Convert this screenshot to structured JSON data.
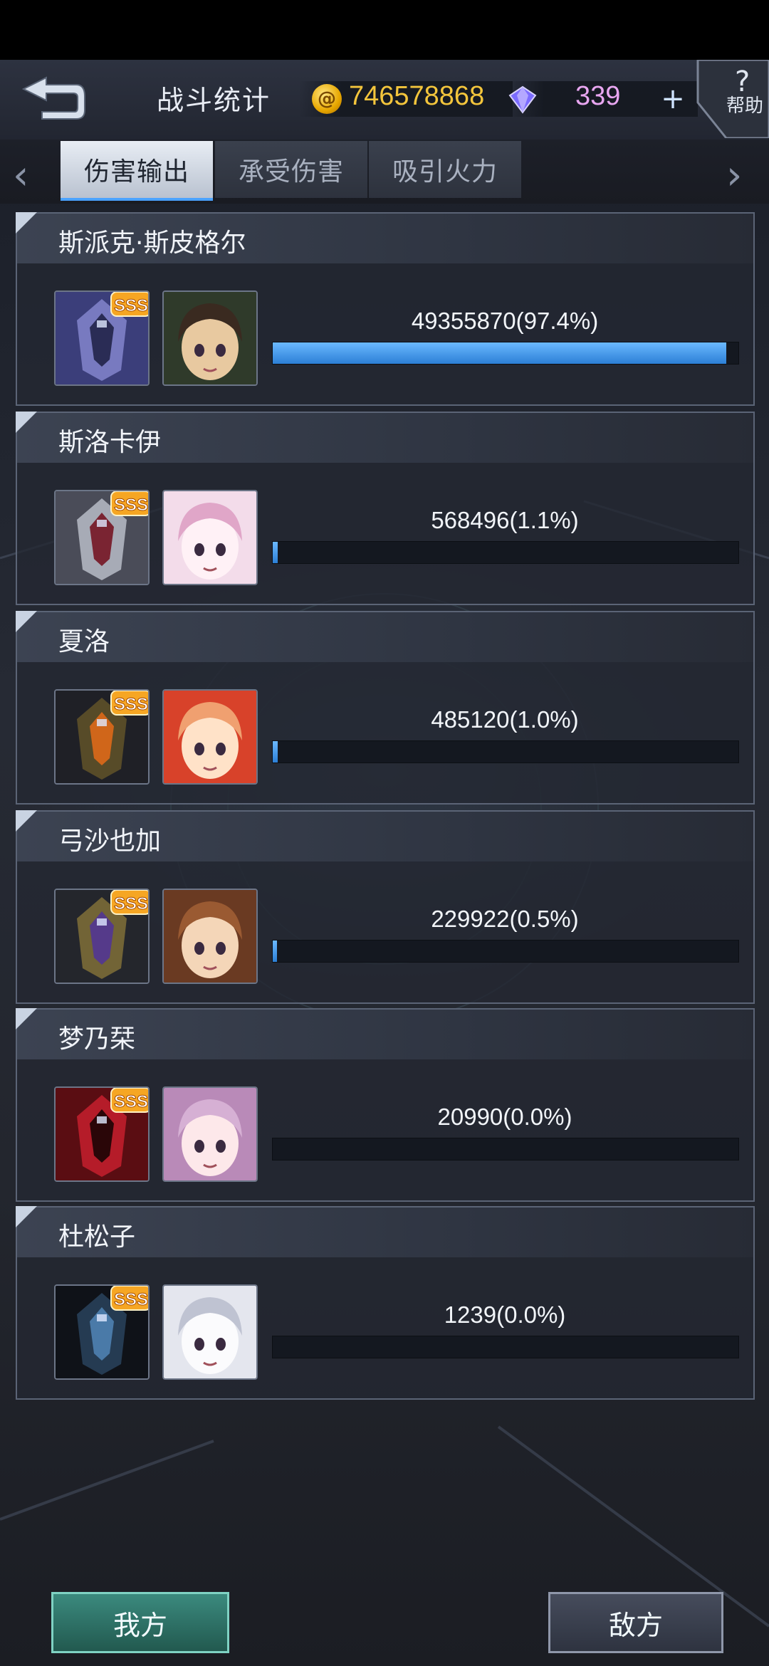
{
  "header": {
    "title": "战斗统计",
    "coins": "746578868",
    "gems": "339",
    "plus_label": "+",
    "help_q": "?",
    "help_label": "帮助"
  },
  "tabs": [
    {
      "label": "伤害输出",
      "active": true
    },
    {
      "label": "承受伤害",
      "active": false
    },
    {
      "label": "吸引火力",
      "active": false
    }
  ],
  "rank_badge": "SSS",
  "entries": [
    {
      "pilot": "斯派克·斯皮格尔",
      "stat": "49355870(97.4%)",
      "percent": 97.4
    },
    {
      "pilot": "斯洛卡伊",
      "stat": "568496(1.1%)",
      "percent": 1.1
    },
    {
      "pilot": "夏洛",
      "stat": "485120(1.0%)",
      "percent": 1.0
    },
    {
      "pilot": "弓沙也加",
      "stat": "229922(0.5%)",
      "percent": 0.5
    },
    {
      "pilot": "梦乃栞",
      "stat": "20990(0.0%)",
      "percent": 0.0
    },
    {
      "pilot": "杜松子",
      "stat": "1239(0.0%)",
      "percent": 0.0
    }
  ],
  "footer": {
    "ours_label": "我方",
    "enemy_label": "敌方"
  },
  "colors": {
    "accent": "#4aa2ff",
    "bar_fill": "#2c7fd6",
    "coin": "#f3c53c",
    "gem": "#e8a6f0",
    "sss": "#f6a623"
  }
}
